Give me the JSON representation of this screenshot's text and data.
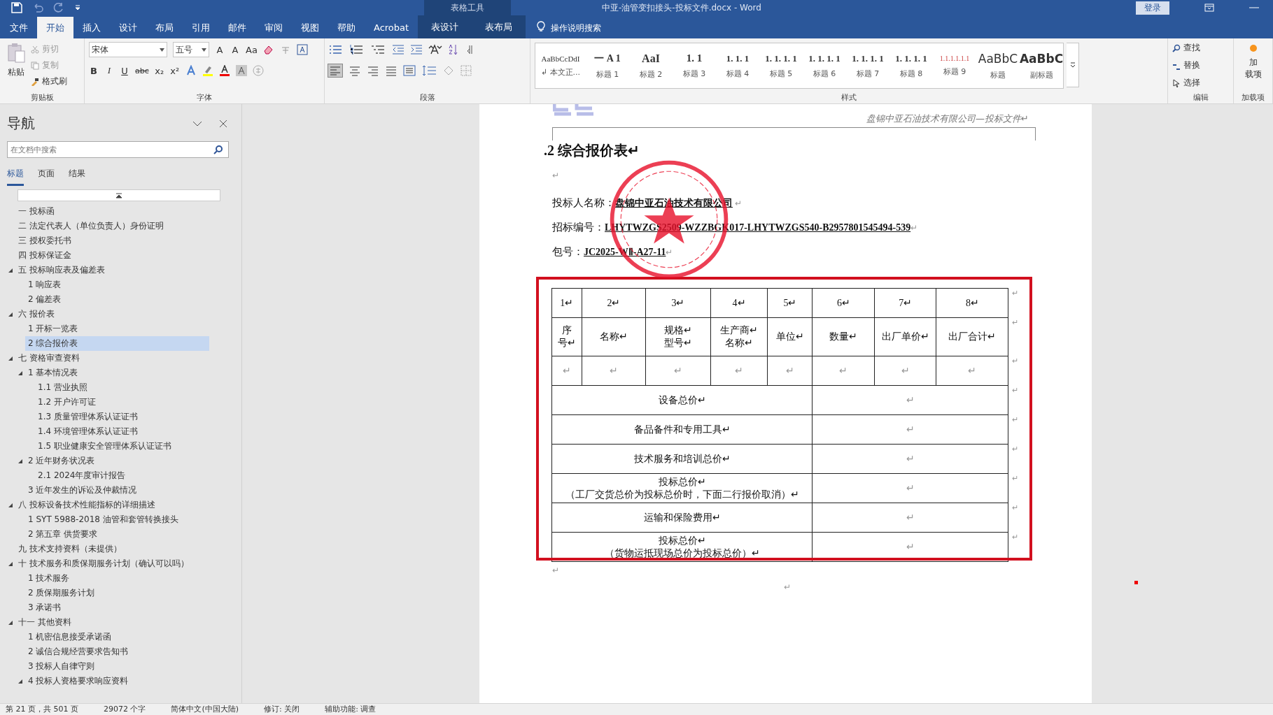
{
  "window": {
    "title": "中亚-油管变扣接头-投标文件.docx  -  Word",
    "context_label": "表格工具",
    "signin": "登录"
  },
  "tabs": [
    {
      "label": "文件",
      "selected": false,
      "kind": "normal"
    },
    {
      "label": "开始",
      "selected": true,
      "kind": "normal"
    },
    {
      "label": "插入",
      "selected": false,
      "kind": "normal"
    },
    {
      "label": "设计",
      "selected": false,
      "kind": "normal"
    },
    {
      "label": "布局",
      "selected": false,
      "kind": "normal"
    },
    {
      "label": "引用",
      "selected": false,
      "kind": "normal"
    },
    {
      "label": "邮件",
      "selected": false,
      "kind": "normal"
    },
    {
      "label": "审阅",
      "selected": false,
      "kind": "normal"
    },
    {
      "label": "视图",
      "selected": false,
      "kind": "normal"
    },
    {
      "label": "帮助",
      "selected": false,
      "kind": "normal"
    },
    {
      "label": "Acrobat",
      "selected": false,
      "kind": "normal"
    },
    {
      "label": "表设计",
      "selected": false,
      "kind": "context"
    },
    {
      "label": "表布局",
      "selected": false,
      "kind": "context"
    }
  ],
  "tell_me": "操作说明搜索",
  "ribbon": {
    "clipboard": {
      "paste": "粘贴",
      "cut": "剪切",
      "copy": "复制",
      "format_painter": "格式刷",
      "label": "剪贴板"
    },
    "font": {
      "name": "宋体",
      "size": "五号",
      "row1": [
        "A",
        "A",
        "Aa"
      ],
      "row2": [
        "B",
        "I",
        "U",
        "abc",
        "x₂",
        "x²"
      ],
      "label": "字体"
    },
    "paragraph": {
      "label": "段落"
    },
    "styles": {
      "label": "样式",
      "items": [
        {
          "preview": "AaBbCcDdI",
          "name": "↲ 本文正..."
        },
        {
          "preview": "一 A 1",
          "name": "标题 1"
        },
        {
          "preview": "AaI",
          "name": "标题 2"
        },
        {
          "preview": "1. 1",
          "name": "标题 3"
        },
        {
          "preview": "1. 1. 1",
          "name": "标题 4"
        },
        {
          "preview": "1. 1. 1. 1",
          "name": "标题 5"
        },
        {
          "preview": "1. 1. 1. 1",
          "name": "标题 6"
        },
        {
          "preview": "1. 1. 1. 1",
          "name": "标题 7"
        },
        {
          "preview": "1. 1. 1. 1",
          "name": "标题 8"
        },
        {
          "preview": "1.1.1.1.1.1",
          "name": "标题 9"
        },
        {
          "preview": "AaBbC",
          "name": "标题"
        },
        {
          "preview": "AaBbC",
          "name": "副标题"
        }
      ]
    },
    "editing": {
      "find": "查找",
      "replace": "替换",
      "select": "选择",
      "label": "编辑"
    },
    "addins": {
      "button": [
        "加",
        "载项"
      ],
      "label": "加载项"
    }
  },
  "nav": {
    "title": "导航",
    "search": {
      "placeholder": "在文档中搜索"
    },
    "tabs": [
      {
        "label": "标题",
        "selected": true
      },
      {
        "label": "页面",
        "selected": false
      },
      {
        "label": "结果",
        "selected": false
      }
    ],
    "items": [
      {
        "label": "一 投标函",
        "selected": false
      },
      {
        "label": "二 法定代表人（单位负责人）身份证明",
        "selected": false
      },
      {
        "label": "三 授权委托书",
        "selected": false
      },
      {
        "label": "四 投标保证金",
        "selected": false
      },
      {
        "label": "五 投标响应表及偏差表",
        "selected": false,
        "expanded": true,
        "children": [
          {
            "label": "1 响应表",
            "selected": false
          },
          {
            "label": "2 偏差表",
            "selected": false
          }
        ]
      },
      {
        "label": "六 报价表",
        "selected": false,
        "expanded": true,
        "children": [
          {
            "label": "1 开标一览表",
            "selected": false
          },
          {
            "label": "2 综合报价表",
            "selected": true
          }
        ]
      },
      {
        "label": "七 资格审查资料",
        "selected": false,
        "expanded": true,
        "children": [
          {
            "label": "1 基本情况表",
            "selected": false,
            "expanded": true,
            "children": [
              {
                "label": "1.1 营业执照",
                "selected": false
              },
              {
                "label": "1.2 开户许可证",
                "selected": false
              },
              {
                "label": "1.3 质量管理体系认证证书",
                "selected": false
              },
              {
                "label": "1.4 环境管理体系认证证书",
                "selected": false
              },
              {
                "label": "1.5 职业健康安全管理体系认证证书",
                "selected": false
              }
            ]
          },
          {
            "label": "2 近年财务状况表",
            "selected": false,
            "expanded": true,
            "children": [
              {
                "label": "2.1 2024年度审计报告",
                "selected": false
              }
            ]
          },
          {
            "label": "3 近年发生的诉讼及仲裁情况",
            "selected": false
          }
        ]
      },
      {
        "label": "八 投标设备技术性能指标的详细描述",
        "selected": false,
        "expanded": true,
        "children": [
          {
            "label": "1 SYT 5988-2018 油管和套管转换接头",
            "selected": false
          },
          {
            "label": "2 第五章 供货要求",
            "selected": false
          }
        ]
      },
      {
        "label": "九 技术支持资料（未提供）",
        "selected": false
      },
      {
        "label": "十 技术服务和质保期服务计划（确认可以吗）",
        "selected": false,
        "expanded": true,
        "children": [
          {
            "label": "1 技术服务",
            "selected": false
          },
          {
            "label": "2 质保期服务计划",
            "selected": false
          },
          {
            "label": "3 承诺书",
            "selected": false
          }
        ]
      },
      {
        "label": "十一 其他资料",
        "selected": false,
        "expanded": true,
        "children": [
          {
            "label": "1 机密信息接受承诺函",
            "selected": false
          },
          {
            "label": "2 诚信合规经营要求告知书",
            "selected": false
          },
          {
            "label": "3 投标人自律守则",
            "selected": false
          },
          {
            "label": "4 投标人资格要求响应资料",
            "selected": false,
            "expanded": true
          }
        ]
      }
    ]
  },
  "document": {
    "header": "盘锦中亚石油技术有限公司—投标文件↵",
    "heading": ".2 综合报价表↵",
    "blank": "↵",
    "fields": [
      {
        "label": "投标人名称：",
        "value": "盘锦中亚石油技术有限公司",
        "end": " ↵"
      },
      {
        "label": "招标编号：",
        "value": "LHYTWZGS2509-WZZBGK017-LHYTWZGS540-B2957801545494-539",
        "end": "↵"
      },
      {
        "label": "包号：",
        "value": "JC2025-WⅡ-A27-11",
        "end": "↵"
      }
    ],
    "table": {
      "numbers": [
        "1↵",
        "2↵",
        "3↵",
        "4↵",
        "5↵",
        "6↵",
        "7↵",
        "8↵"
      ],
      "headers": [
        [
          "序",
          "号↵"
        ],
        [
          "名称↵"
        ],
        [
          "规格↵",
          "型号↵"
        ],
        [
          "生产商↵",
          "名称↵"
        ],
        [
          "单位↵"
        ],
        [
          "数量↵"
        ],
        [
          "出厂单价↵"
        ],
        [
          "出厂合计↵"
        ]
      ],
      "empty_row": [
        "↵",
        "↵",
        "↵",
        "↵",
        "↵",
        "↵",
        "↵",
        "↵"
      ],
      "summary": [
        {
          "label": "设备总价↵",
          "value": "↵"
        },
        {
          "label": "备品备件和专用工具↵",
          "value": "↵"
        },
        {
          "label": "技术服务和培训总价↵",
          "value": "↵"
        },
        {
          "label": "投标总价↵",
          "note": "（工厂交货总价为投标总价时，下面二行报价取消）↵",
          "value": "↵"
        },
        {
          "label": "运输和保险费用↵",
          "value": "↵"
        },
        {
          "label": "投标总价↵",
          "note": "（货物运抵现场总价为投标总价）↵",
          "value": "↵"
        }
      ],
      "row_end": "↵"
    },
    "after_table": "↵",
    "centered_mark": "↵"
  },
  "status_bar": [
    "第 21 页，共 501 页",
    "29072 个字",
    "简体中文(中国大陆)",
    "修订: 关闭",
    "辅助功能: 调查"
  ]
}
